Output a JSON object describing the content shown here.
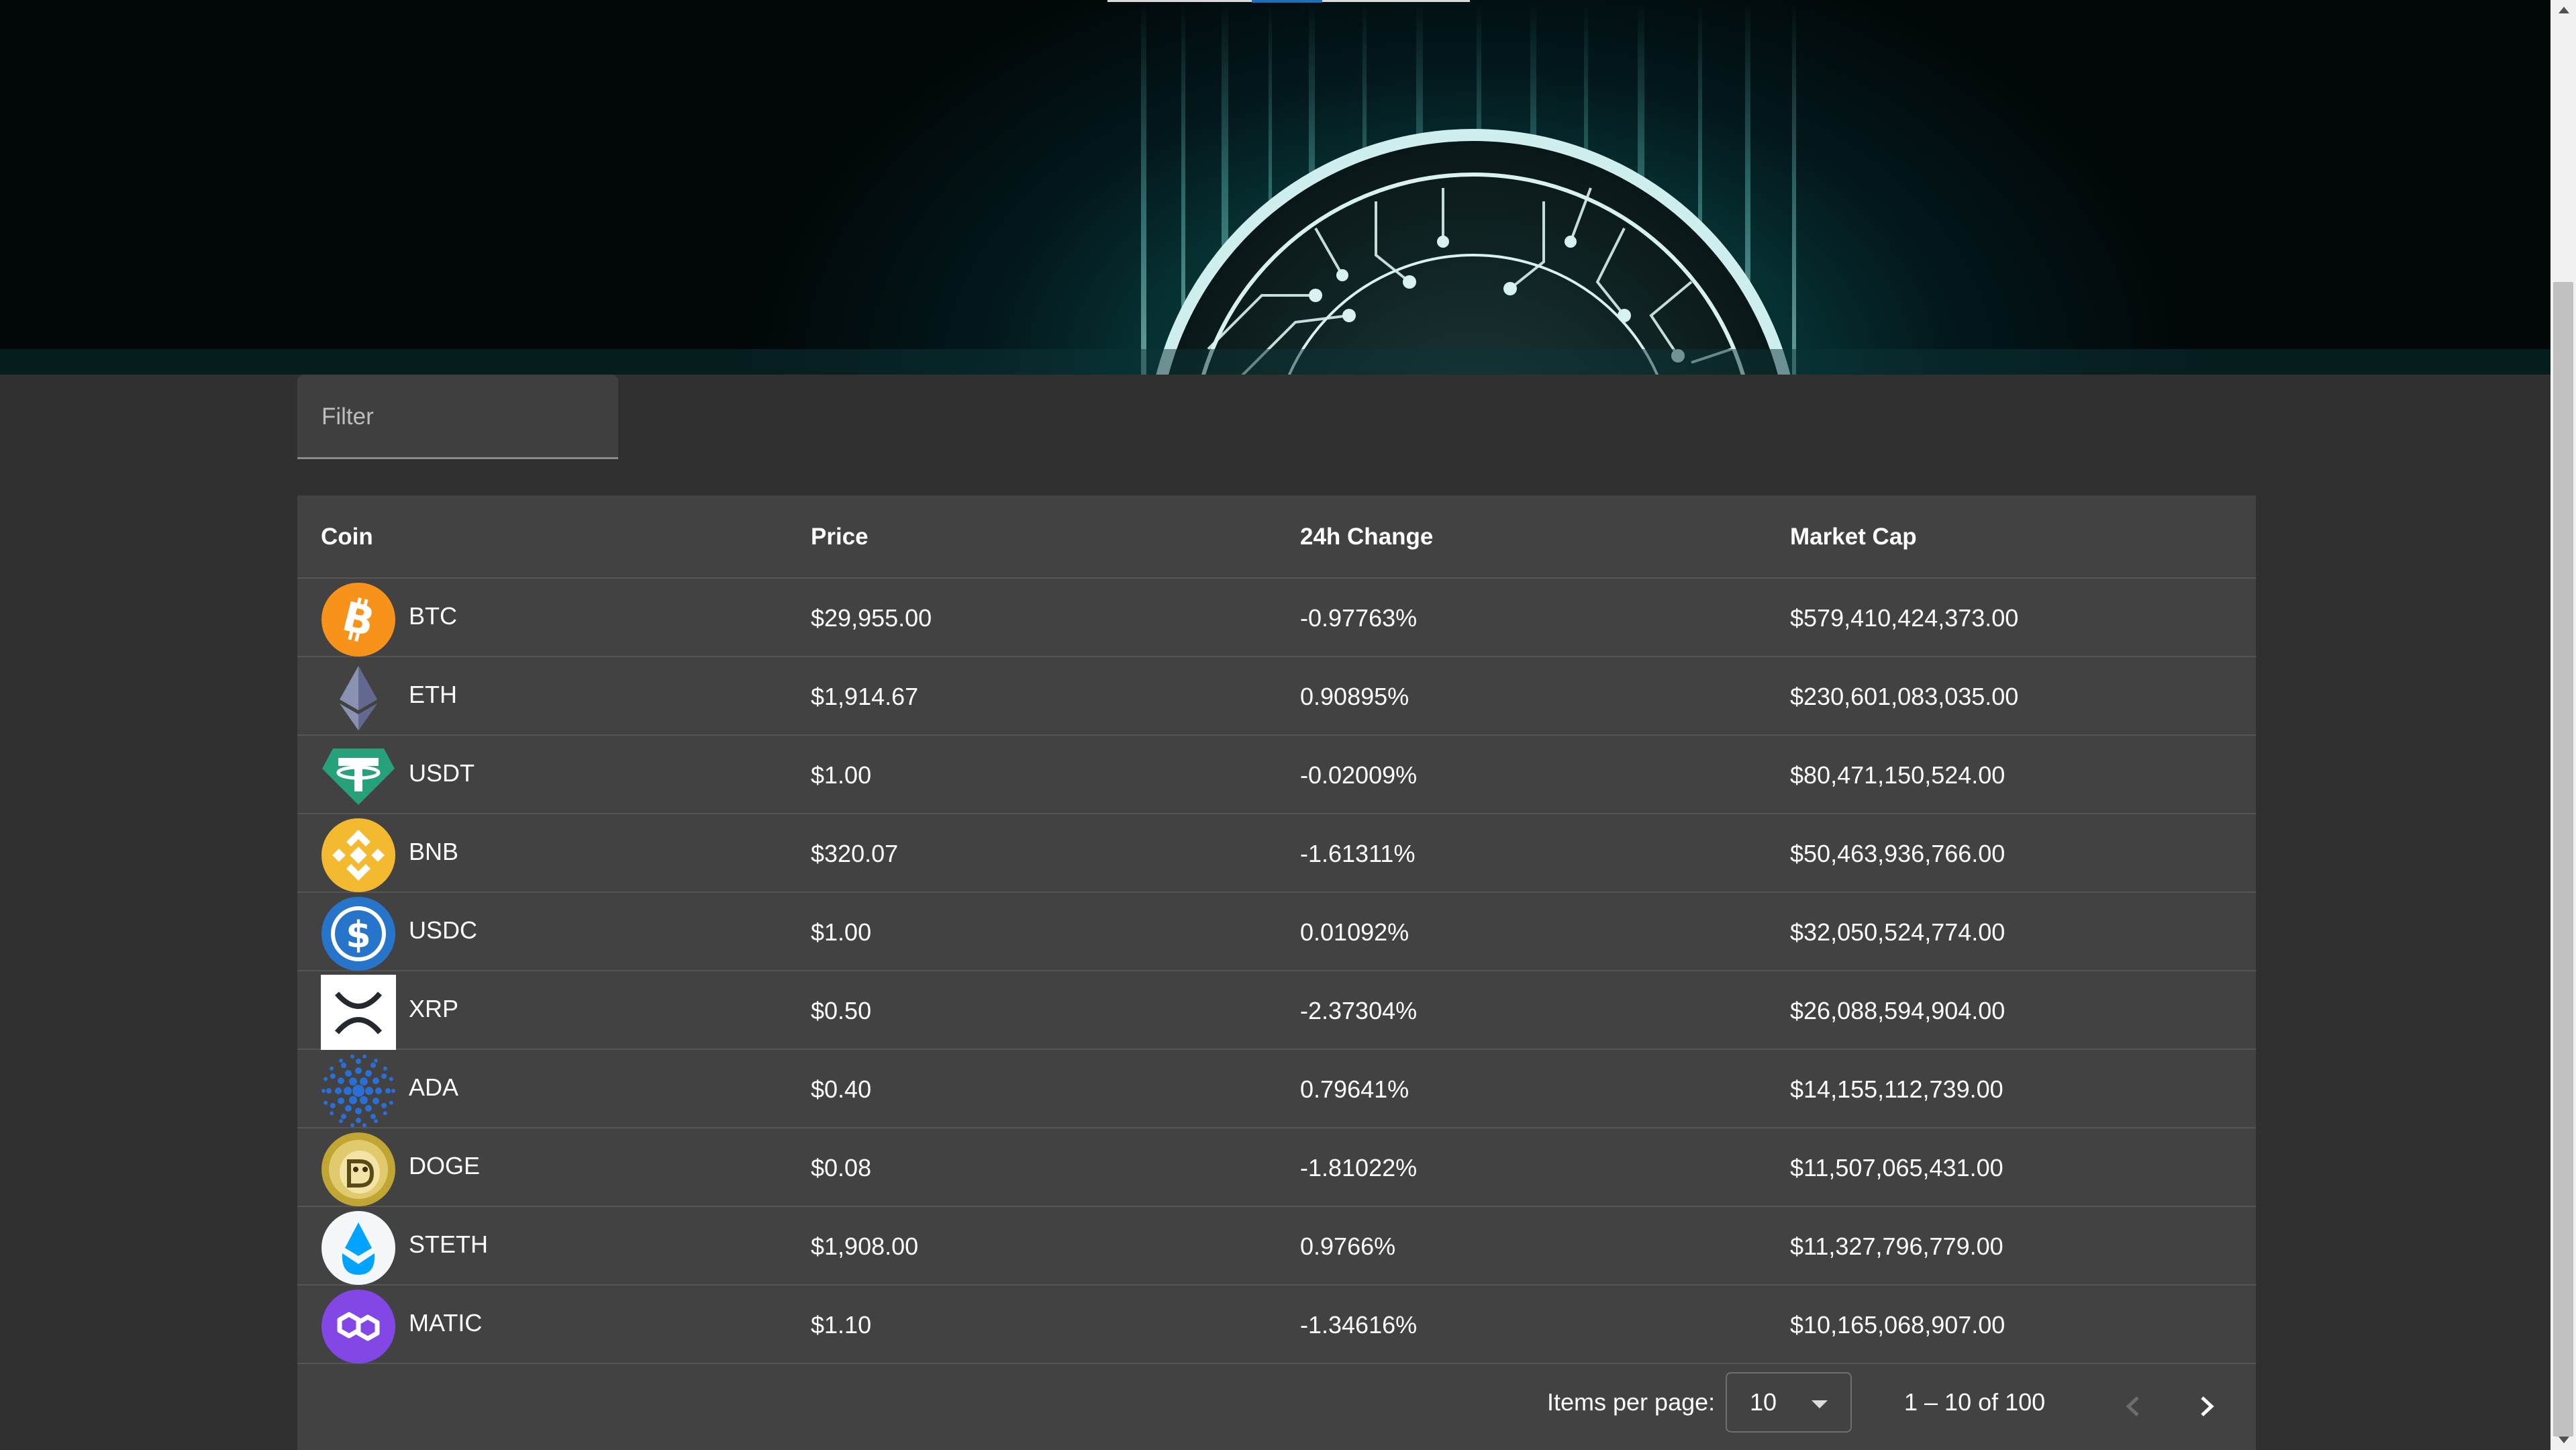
{
  "filter": {
    "placeholder": "Filter"
  },
  "table": {
    "headers": {
      "coin": "Coin",
      "price": "Price",
      "change": "24h Change",
      "market_cap": "Market Cap"
    },
    "rows": [
      {
        "symbol": "BTC",
        "icon": "bitcoin-icon",
        "color": "#f7931a",
        "price": "$29,955.00",
        "change": "-0.97763%",
        "market_cap": "$579,410,424,373.00"
      },
      {
        "symbol": "ETH",
        "icon": "ethereum-icon",
        "color": "#627eea",
        "price": "$1,914.67",
        "change": "0.90895%",
        "market_cap": "$230,601,083,035.00"
      },
      {
        "symbol": "USDT",
        "icon": "tether-icon",
        "color": "#26a17b",
        "price": "$1.00",
        "change": "-0.02009%",
        "market_cap": "$80,471,150,524.00"
      },
      {
        "symbol": "BNB",
        "icon": "bnb-icon",
        "color": "#f3ba2f",
        "price": "$320.07",
        "change": "-1.61311%",
        "market_cap": "$50,463,936,766.00"
      },
      {
        "symbol": "USDC",
        "icon": "usdc-icon",
        "color": "#2775ca",
        "price": "$1.00",
        "change": "0.01092%",
        "market_cap": "$32,050,524,774.00"
      },
      {
        "symbol": "XRP",
        "icon": "xrp-icon",
        "color": "#ffffff",
        "price": "$0.50",
        "change": "-2.37304%",
        "market_cap": "$26,088,594,904.00"
      },
      {
        "symbol": "ADA",
        "icon": "cardano-icon",
        "color": "#2a6fd6",
        "price": "$0.40",
        "change": "0.79641%",
        "market_cap": "$14,155,112,739.00"
      },
      {
        "symbol": "DOGE",
        "icon": "dogecoin-icon",
        "color": "#c2a633",
        "price": "$0.08",
        "change": "-1.81022%",
        "market_cap": "$11,507,065,431.00"
      },
      {
        "symbol": "STETH",
        "icon": "steth-icon",
        "color": "#00a3ff",
        "price": "$1,908.00",
        "change": "0.9766%",
        "market_cap": "$11,327,796,779.00"
      },
      {
        "symbol": "MATIC",
        "icon": "polygon-icon",
        "color": "#8247e5",
        "price": "$1.10",
        "change": "-1.34616%",
        "market_cap": "$10,165,068,907.00"
      }
    ]
  },
  "paginator": {
    "items_per_page_label": "Items per page:",
    "items_per_page_value": "10",
    "range_label": "1 – 10 of 100"
  }
}
